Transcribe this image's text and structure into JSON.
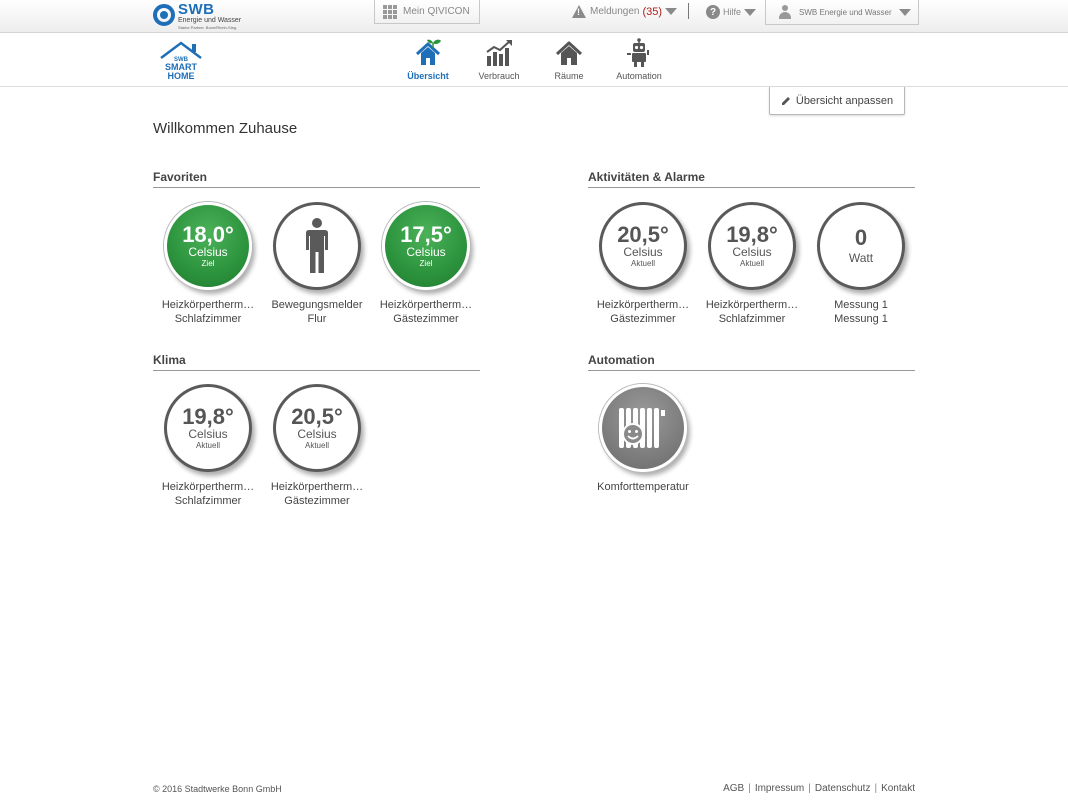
{
  "brand": {
    "name": "SWB",
    "subtitle": "Energie und Wasser",
    "tagline": "Starke Partner. Bonn/Rhein-Sieg.",
    "accent_color": "#1e6fb8"
  },
  "topbar": {
    "qivicon_label": "Mein QIVICON",
    "alerts_label": "Meldungen",
    "alerts_count": "(35)",
    "help_label": "Hilfe",
    "account_label": "SWB Energie und Wasser"
  },
  "logo": {
    "line1": "SWB",
    "line2": "SMART",
    "line3": "HOME"
  },
  "nav": {
    "items": [
      {
        "label": "Übersicht",
        "icon": "house-plant-icon",
        "active": true
      },
      {
        "label": "Verbrauch",
        "icon": "bar-chart-icon",
        "active": false
      },
      {
        "label": "Räume",
        "icon": "house-icon",
        "active": false
      },
      {
        "label": "Automation",
        "icon": "robot-icon",
        "active": false
      }
    ]
  },
  "customize_label": "Übersicht anpassen",
  "page_title": "Willkommen Zuhause",
  "sections": {
    "favoriten": {
      "title": "Favoriten",
      "tiles": [
        {
          "value": "18,0°",
          "unit": "Celsius",
          "sub": "Ziel",
          "name": "Heizkörpertherm…",
          "room": "Schlafzimmer"
        },
        {
          "name": "Bewegungsmelder",
          "room": "Flur",
          "icon": "person-icon"
        },
        {
          "value": "17,5°",
          "unit": "Celsius",
          "sub": "Ziel",
          "name": "Heizkörpertherm…",
          "room": "Gästezimmer"
        }
      ]
    },
    "aktivitaeten": {
      "title": "Aktivitäten & Alarme",
      "tiles": [
        {
          "value": "20,5°",
          "unit": "Celsius",
          "sub": "Aktuell",
          "name": "Heizkörpertherm…",
          "room": "Gästezimmer"
        },
        {
          "value": "19,8°",
          "unit": "Celsius",
          "sub": "Aktuell",
          "name": "Heizkörpertherm…",
          "room": "Schlafzimmer"
        },
        {
          "value": "0",
          "unit": "Watt",
          "name": "Messung 1",
          "room": "Messung 1"
        }
      ]
    },
    "klima": {
      "title": "Klima",
      "tiles": [
        {
          "value": "19,8°",
          "unit": "Celsius",
          "sub": "Aktuell",
          "name": "Heizkörpertherm…",
          "room": "Schlafzimmer"
        },
        {
          "value": "20,5°",
          "unit": "Celsius",
          "sub": "Aktuell",
          "name": "Heizkörpertherm…",
          "room": "Gästezimmer"
        }
      ]
    },
    "automation": {
      "title": "Automation",
      "tiles": [
        {
          "name": "Komforttemperatur",
          "icon": "radiator-smile-icon"
        }
      ]
    }
  },
  "colors": {
    "target_green": "#2e963f",
    "alert_red": "#b11c1c",
    "nav_active": "#1e6fb8"
  },
  "footer": {
    "copyright": "© 2016 Stadtwerke Bonn GmbH",
    "links": [
      "AGB",
      "Impressum",
      "Datenschutz",
      "Kontakt"
    ]
  }
}
